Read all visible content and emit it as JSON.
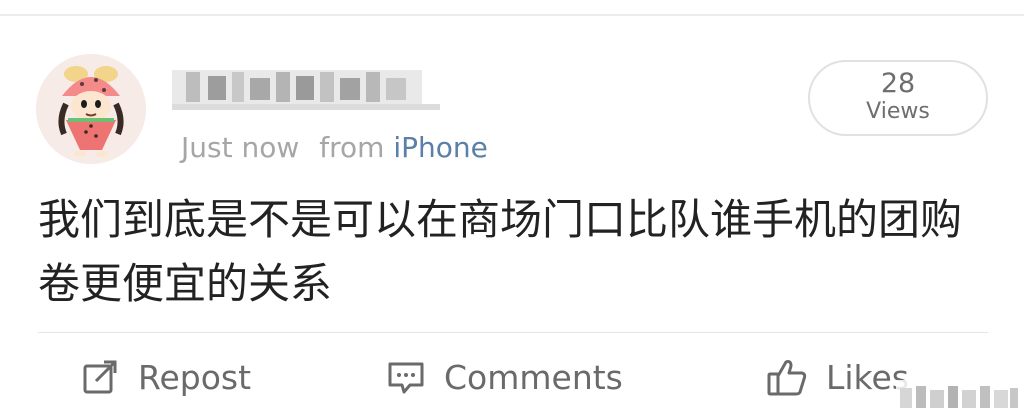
{
  "post": {
    "author": {
      "name": "",
      "avatar_icon": "cartoon-child-watermelon-avatar"
    },
    "time": "Just now",
    "from_label": "from",
    "source": "iPhone",
    "views": {
      "count": "28",
      "label": "Views"
    },
    "text": "我们到底是不是可以在商场门口比队谁手机的团购卷更便宜的关系"
  },
  "actions": {
    "repost": {
      "label": "Repost",
      "icon": "repost-icon"
    },
    "comments": {
      "label": "Comments",
      "icon": "comment-icon"
    },
    "likes": {
      "label": "Likes",
      "icon": "thumbs-up-icon"
    }
  },
  "colors": {
    "source_link": "#5b7fa6",
    "meta_text": "#a6a6a6",
    "body_text": "#222222",
    "action_text": "#6a6a6a"
  }
}
